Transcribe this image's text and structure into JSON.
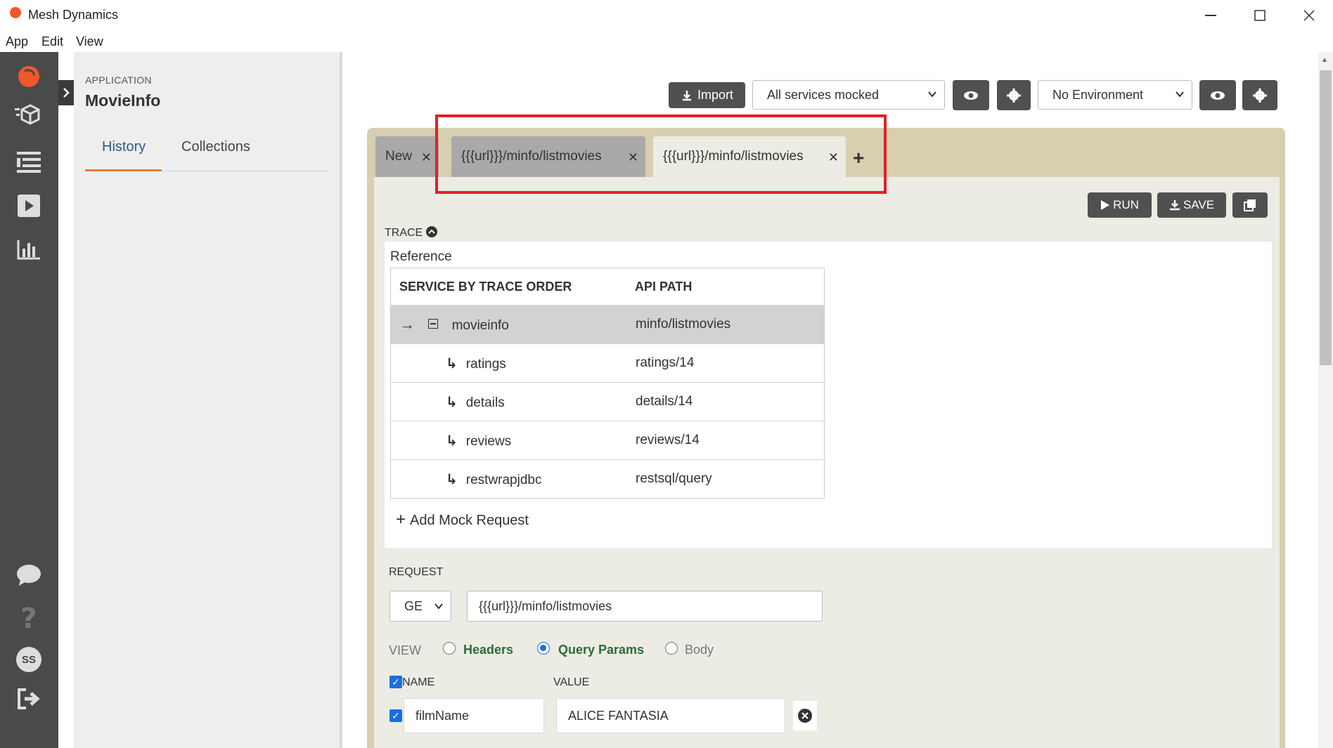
{
  "window": {
    "title": "Mesh Dynamics"
  },
  "menu": [
    "App",
    "Edit",
    "View"
  ],
  "sidebar": {
    "app_label": "APPLICATION",
    "app_name": "MovieInfo",
    "tabs": [
      "History",
      "Collections"
    ],
    "user_initials": "SS"
  },
  "toolbar": {
    "import_label": "Import",
    "mock_select_value": "All services mocked",
    "env_select_value": "No Environment"
  },
  "request_tabs": [
    {
      "label": "New"
    },
    {
      "label": "{{{url}}}/minfo/listmovies"
    },
    {
      "label": "{{{url}}}/minfo/listmovies",
      "active": true
    }
  ],
  "actions": {
    "run_label": "RUN",
    "save_label": "SAVE"
  },
  "trace": {
    "label": "TRACE",
    "reference_label": "Reference",
    "columns": [
      "SERVICE BY TRACE ORDER",
      "API PATH"
    ],
    "rows": [
      {
        "service": "movieinfo",
        "path": "minfo/listmovies"
      },
      {
        "service": "ratings",
        "path": "ratings/14"
      },
      {
        "service": "details",
        "path": "details/14"
      },
      {
        "service": "reviews",
        "path": "reviews/14"
      },
      {
        "service": "restwrapjdbc",
        "path": "restsql/query"
      }
    ],
    "add_mock_label": "Add Mock Request"
  },
  "request": {
    "label": "REQUEST",
    "method": "GE",
    "url": "{{{url}}}/minfo/listmovies",
    "view_label": "VIEW",
    "view_options": [
      "Headers",
      "Query Params",
      "Body"
    ],
    "params_columns": [
      "NAME",
      "VALUE"
    ],
    "params": [
      {
        "name": "filmName",
        "value": "ALICE FANTASIA"
      }
    ]
  },
  "colors": {
    "accent": "#f07a2e",
    "rail": "#4a4a4a",
    "highlight": "#e0202a",
    "radio_on": "#1a6fe0"
  }
}
